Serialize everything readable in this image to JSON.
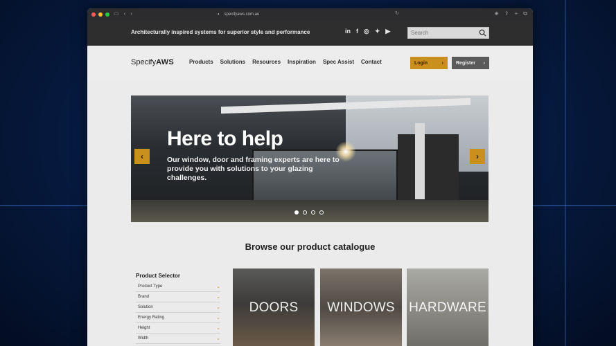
{
  "browser": {
    "url": "specifyaws.com.au",
    "traffic_lights": [
      "#ff5f57",
      "#febc2e",
      "#28c840"
    ]
  },
  "topbar": {
    "tagline": "Architecturally inspired systems for superior style and performance",
    "socials": [
      "linkedin-icon",
      "facebook-icon",
      "instagram-icon",
      "twitter-icon",
      "youtube-icon"
    ],
    "search_placeholder": "Search"
  },
  "nav": {
    "logo_light": "Specify",
    "logo_bold": "AWS",
    "links": [
      "Products",
      "Solutions",
      "Resources",
      "Inspiration",
      "Spec Assist",
      "Contact"
    ],
    "login_label": "Login",
    "register_label": "Register",
    "accent_color": "#c9901e"
  },
  "hero": {
    "title": "Here to help",
    "subtitle": "Our window, door and framing experts are here to provide you with solutions to your glazing challenges.",
    "slides": 4,
    "active_slide": 1
  },
  "catalogue": {
    "title": "Browse our product catalogue",
    "selector_title": "Product Selector",
    "filters": [
      "Product Type",
      "Brand",
      "Solution",
      "Energy Rating",
      "Height",
      "Width"
    ],
    "categories": [
      "DOORS",
      "WINDOWS",
      "HARDWARE"
    ]
  }
}
